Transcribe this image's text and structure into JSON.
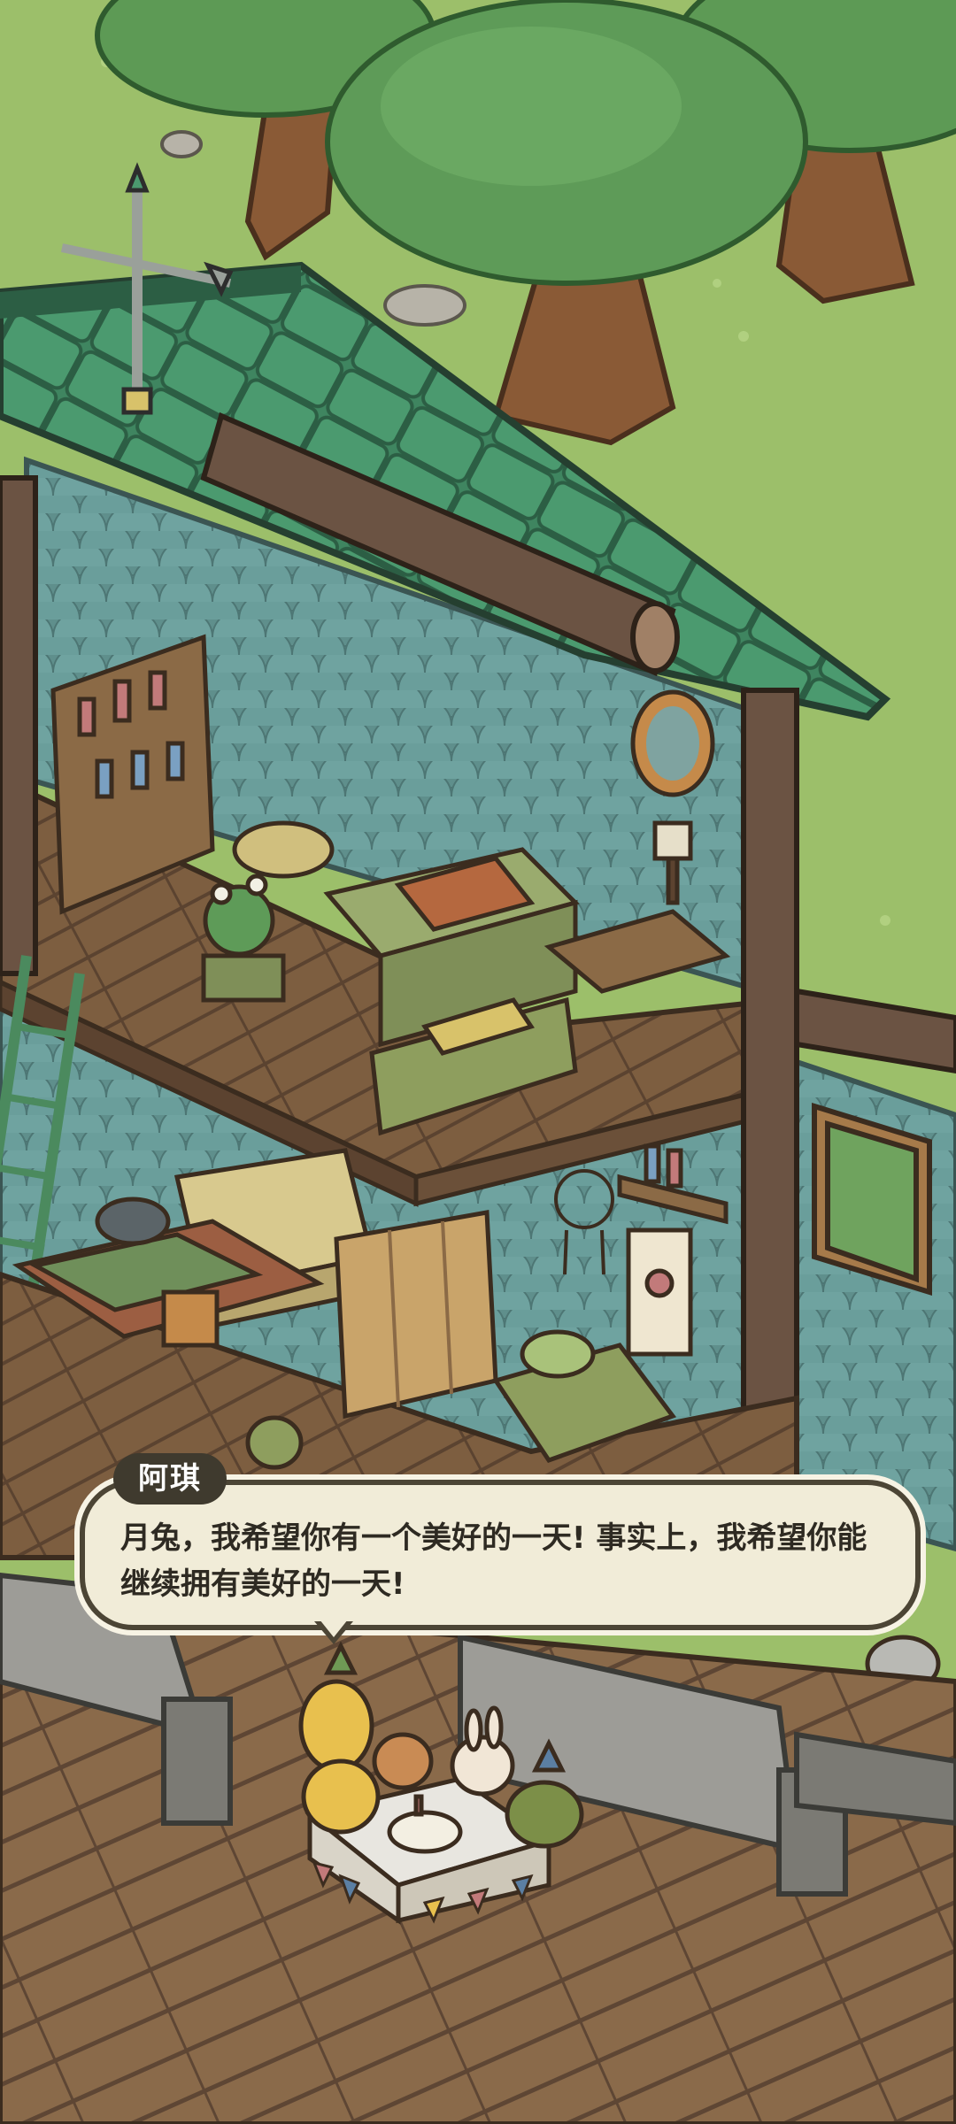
{
  "dialogue": {
    "speaker": "阿琪",
    "text": "月兔，我希望你有一个美好的一天! 事实上，我希望你能继续拥有美好的一天!"
  },
  "colors": {
    "grass": "#9cbf6a",
    "roof": "#3f8560",
    "wood_floor": "#7a5a3c",
    "wall_pattern": "#6b9a96",
    "dialog_bg": "#f1ecd8",
    "dialog_border": "#4c4535"
  }
}
